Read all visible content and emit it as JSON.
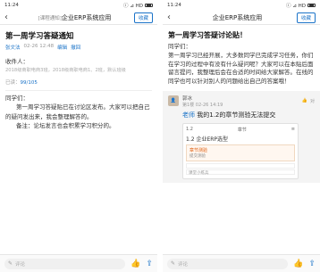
{
  "left": {
    "status": {
      "time": "11:24",
      "signal": "ⓘ ⊿ HD"
    },
    "nav": {
      "back": "‹",
      "tag": "[课程通知]",
      "title": "企业ERP系统应用",
      "fav": "收藏"
    },
    "post": {
      "title": "第一周学习答疑通知",
      "author": "张文法",
      "date": "02-26 12:48",
      "edit": "编辑",
      "withdraw": "撤回",
      "recipients_label": "收件人：",
      "recipients": "2018级商职电商3班，2018级商职电商1、2班，默认班级",
      "read_label": "已读：",
      "read_count": "99/105",
      "greeting": "同学们：",
      "p1": "第一周学习答疑贴已在讨论区发布。大家可以把自己的疑问发出来，我会整理解答的。",
      "p2": "备注：论坛发言也会积累学习积分的。"
    },
    "bottom": {
      "placeholder": "评论",
      "like": "👍",
      "share": "⇪"
    }
  },
  "right": {
    "status": {
      "time": "11:24",
      "signal": "ⓘ ⊿ HD"
    },
    "nav": {
      "back": "‹",
      "title": "企业ERP系统应用",
      "fav": "收藏"
    },
    "post": {
      "title": "第一周学习答疑讨论贴！",
      "greeting": "同学们：",
      "body": "第一周学习已经开展，大多数同学已完成学习任务，你们在学习的过程中有没有什么疑问呢？大家可以在本贴后面留言提问，我整理后会在合适的时间给大家解答。在线的同学也可以针对别人的问题给出自己的答案哦！"
    },
    "comment": {
      "name": "郭冰",
      "floor": "第1楼",
      "time": "02-26 14:19",
      "reply": "对",
      "text_who": "老师",
      "text": "我的1.2的章节测验无法提交",
      "attach": {
        "top_left": "1.2",
        "top_mid": "章节",
        "title": "1.2 企业ERP选型",
        "card_head": "章节测验",
        "card_line": "提交测验",
        "line1": "",
        "line2": "课堂小练兵"
      }
    },
    "bottom": {
      "placeholder": "评论",
      "like": "👍",
      "share": "⇪"
    }
  }
}
